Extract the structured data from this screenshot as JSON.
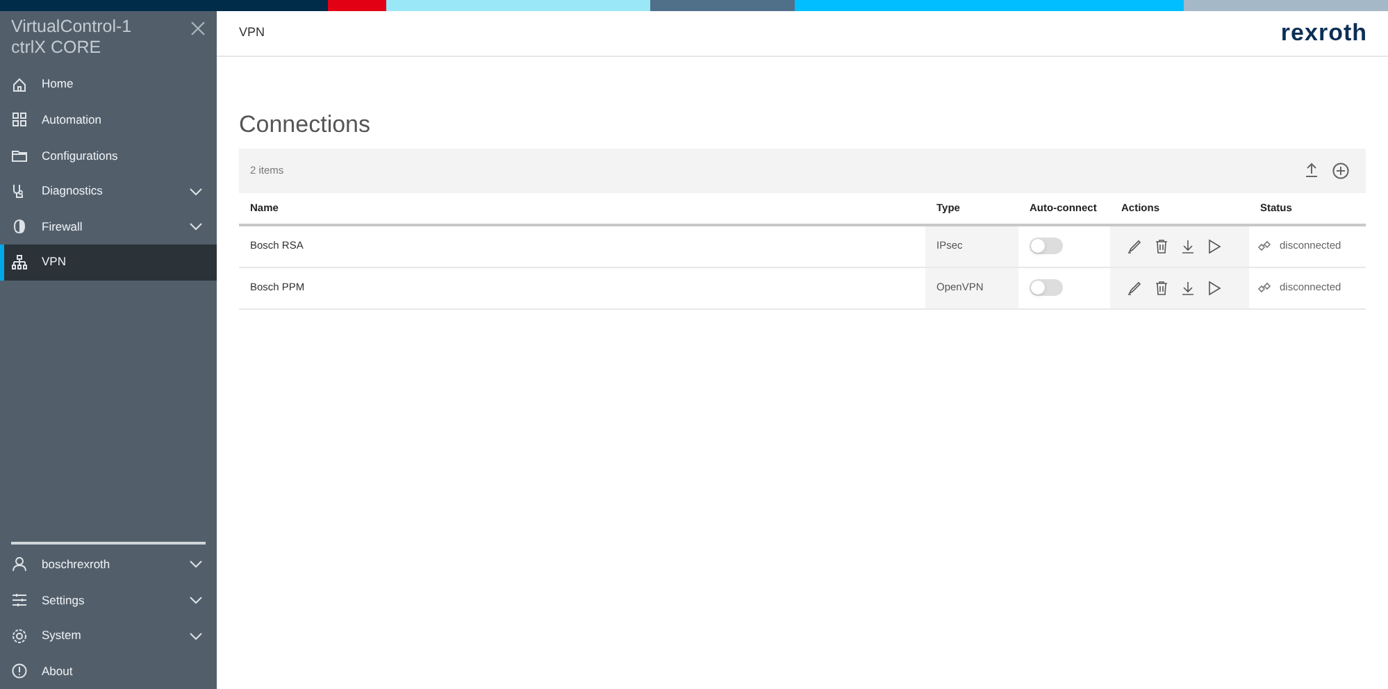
{
  "sidebar": {
    "title_lines": [
      "VirtualControl-1",
      "ctrlX CORE"
    ],
    "items": [
      {
        "label": "Home",
        "expandable": false,
        "selected": false
      },
      {
        "label": "Automation",
        "expandable": false,
        "selected": false
      },
      {
        "label": "Configurations",
        "expandable": false,
        "selected": false
      },
      {
        "label": "Diagnostics",
        "expandable": true,
        "selected": false
      },
      {
        "label": "Firewall",
        "expandable": true,
        "selected": false
      },
      {
        "label": "VPN",
        "expandable": false,
        "selected": true
      }
    ],
    "bottom_items": [
      {
        "label": "boschrexroth",
        "expandable": true,
        "selected": false
      },
      {
        "label": "Settings",
        "expandable": true,
        "selected": false
      },
      {
        "label": "System",
        "expandable": true,
        "selected": false
      },
      {
        "label": "About",
        "expandable": false,
        "selected": false
      }
    ]
  },
  "header": {
    "breadcrumb": "VPN",
    "logo": "rexroth"
  },
  "page_title": "Connections",
  "table": {
    "count": "2 items",
    "columns": [
      "Name",
      "Type",
      "Auto-connect",
      "Actions",
      "Status"
    ],
    "rows": [
      {
        "name": "Bosch RSA",
        "type": "IPsec",
        "auto_connect": false,
        "status": "disconnected"
      },
      {
        "name": "Bosch PPM",
        "type": "OpenVPN",
        "auto_connect": false,
        "status": "disconnected"
      }
    ]
  }
}
